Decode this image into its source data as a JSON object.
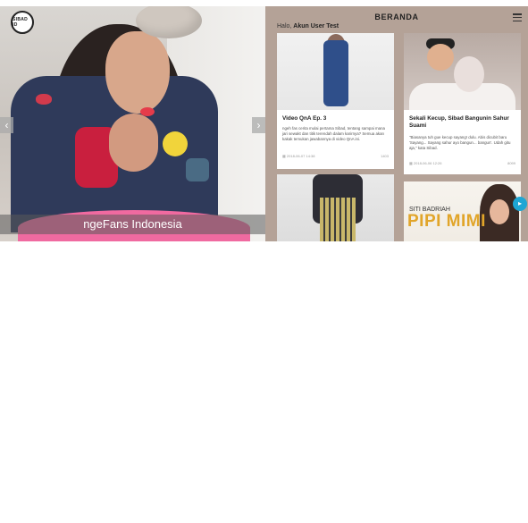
{
  "brand": {
    "logo_text": "SIBAD ID"
  },
  "hero": {
    "caption": "ngeFans Indonesia",
    "prev_icon": "chevron-left-icon",
    "next_icon": "chevron-right-icon",
    "prev_glyph": "‹",
    "next_glyph": "›"
  },
  "panel": {
    "title": "BERANDA",
    "greeting_prefix": "Halo,",
    "user_name": "Akun User Test",
    "menu_icon": "hamburger-menu-icon"
  },
  "cards": [
    {
      "title": "Video QnA Ep. 3",
      "excerpt": "ngeh fas cerita mulai pertama Sibad, tentang sampai mana jari sewakt dan titik terendah dalam karirnya? Semua akan kakak temukan jawabannya di video QnA ini.",
      "date": "2018-06-07 14:38",
      "views": "1403"
    },
    {
      "title": "Sekali Kecup, Sibad Bangunin Sahur Suami",
      "excerpt": "\"Biasanya tuh gue kecup sayang! dulu. Abis dicubit baru 'Sayang... Sayang sahur ayo bangun... bangun'. Udah gitu aja,\" kata Sibad.",
      "date": "2018-06-06 12:26",
      "views": "8099"
    },
    {
      "title": "",
      "excerpt": "",
      "date": "",
      "views": ""
    },
    {
      "title": "",
      "excerpt": "",
      "date": "",
      "views": "",
      "image_text_small": "SITI BADRIAH",
      "image_text_big": "PIPI MIMI"
    }
  ],
  "float_button": {
    "icon": "floating-action-icon",
    "glyph": "▸"
  },
  "colors": {
    "panel_bg": "#b4a297",
    "accent": "#1ea6d4"
  }
}
